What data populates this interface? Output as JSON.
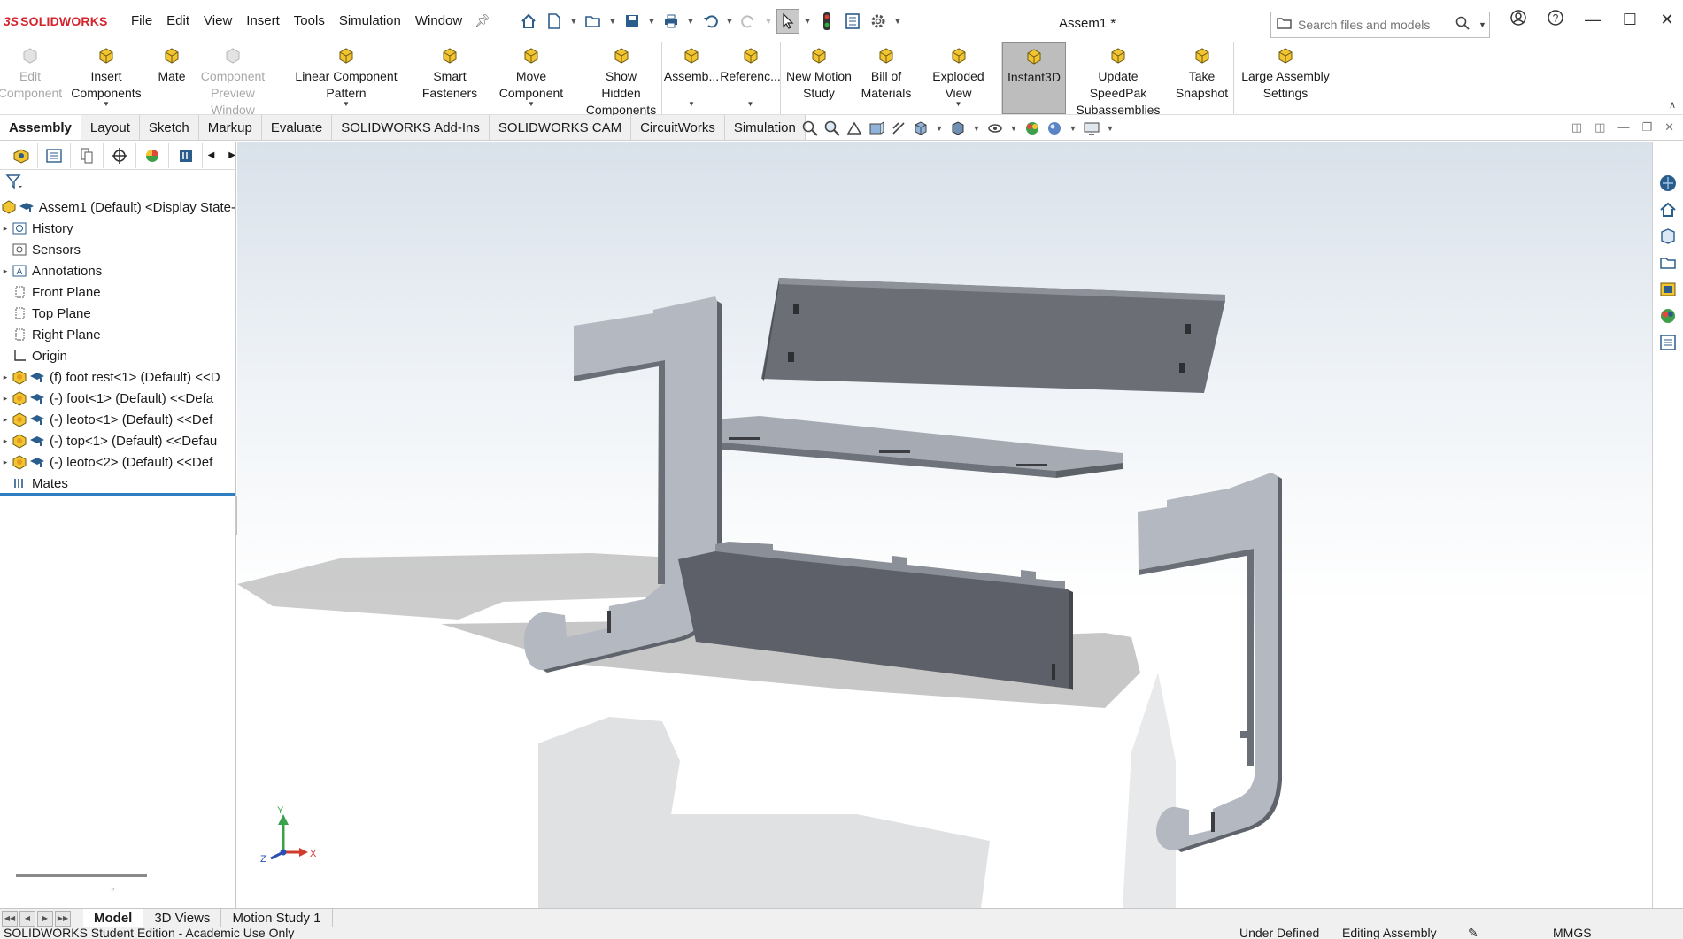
{
  "app": {
    "logo_ds": "3S",
    "logo_text": "SOLIDWORKS",
    "document_title": "Assem1 *"
  },
  "menu": [
    "File",
    "Edit",
    "View",
    "Insert",
    "Tools",
    "Simulation",
    "Window"
  ],
  "search": {
    "placeholder": "Search files and models"
  },
  "commands": [
    {
      "label": "Edit\nComponent",
      "icon": "edit-component-icon",
      "enabled": false
    },
    {
      "label": "Insert Components",
      "icon": "insert-components-icon",
      "enabled": true,
      "dropdown": true
    },
    {
      "label": "Mate",
      "icon": "mate-icon",
      "enabled": true
    },
    {
      "label": "Component\nPreview Window",
      "icon": "preview-window-icon",
      "enabled": false
    },
    {
      "label": "Linear Component Pattern",
      "icon": "linear-pattern-icon",
      "enabled": true,
      "dropdown": true
    },
    {
      "label": "Smart\nFasteners",
      "icon": "smart-fasteners-icon",
      "enabled": true
    },
    {
      "label": "Move Component",
      "icon": "move-component-icon",
      "enabled": true,
      "dropdown": true
    },
    {
      "label": "Show Hidden\nComponents",
      "icon": "show-hidden-icon",
      "enabled": true
    },
    {
      "label": "Assemb...",
      "icon": "assembly-features-icon",
      "enabled": true,
      "dropdown": true
    },
    {
      "label": "Referenc...",
      "icon": "reference-geometry-icon",
      "enabled": true,
      "dropdown": true
    },
    {
      "label": "New Motion\nStudy",
      "icon": "motion-study-icon",
      "enabled": true
    },
    {
      "label": "Bill of\nMaterials",
      "icon": "bill-of-materials-icon",
      "enabled": true
    },
    {
      "label": "Exploded View",
      "icon": "exploded-view-icon",
      "enabled": true,
      "dropdown": true
    },
    {
      "label": "Instant3D",
      "icon": "instant3d-icon",
      "enabled": true,
      "active": true
    },
    {
      "label": "Update SpeedPak\nSubassemblies",
      "icon": "speedpak-icon",
      "enabled": true
    },
    {
      "label": "Take\nSnapshot",
      "icon": "snapshot-icon",
      "enabled": true
    },
    {
      "label": "Large Assembly\nSettings",
      "icon": "large-assembly-icon",
      "enabled": true
    }
  ],
  "tabs": [
    "Assembly",
    "Layout",
    "Sketch",
    "Markup",
    "Evaluate",
    "SOLIDWORKS Add-Ins",
    "SOLIDWORKS CAM",
    "CircuitWorks",
    "Simulation"
  ],
  "active_tab": "Assembly",
  "tree": {
    "root": "Assem1 (Default) <Display State-",
    "items": [
      {
        "label": "History",
        "icon": "history-icon",
        "expandable": true
      },
      {
        "label": "Sensors",
        "icon": "sensors-icon",
        "expandable": false
      },
      {
        "label": "Annotations",
        "icon": "annotations-icon",
        "expandable": true
      },
      {
        "label": "Front Plane",
        "icon": "plane-icon",
        "expandable": false
      },
      {
        "label": "Top Plane",
        "icon": "plane-icon",
        "expandable": false
      },
      {
        "label": "Right Plane",
        "icon": "plane-icon",
        "expandable": false
      },
      {
        "label": "Origin",
        "icon": "origin-icon",
        "expandable": false
      },
      {
        "label": "(f) foot rest<1> (Default) <<D",
        "icon": "part-icon",
        "expandable": true
      },
      {
        "label": "(-) foot<1> (Default) <<Defa",
        "icon": "part-icon",
        "expandable": true
      },
      {
        "label": "(-) leoto<1> (Default) <<Def",
        "icon": "part-icon",
        "expandable": true
      },
      {
        "label": "(-) top<1> (Default) <<Defau",
        "icon": "part-icon",
        "expandable": true
      },
      {
        "label": "(-) leoto<2> (Default) <<Def",
        "icon": "part-icon",
        "expandable": true
      },
      {
        "label": "Mates",
        "icon": "mates-icon",
        "expandable": false
      }
    ]
  },
  "triad": {
    "y": "Y",
    "x": "X",
    "z": "Z"
  },
  "bottom_tabs": [
    "Model",
    "3D Views",
    "Motion Study 1"
  ],
  "active_bottom_tab": "Model",
  "status": {
    "left": "SOLIDWORKS Student Edition - Academic Use Only",
    "defined": "Under Defined",
    "mode": "Editing Assembly",
    "units": "MMGS"
  },
  "colors": {
    "accent": "#2d7fc1",
    "brand": "#d4232c",
    "part": "#9aa0ab"
  }
}
